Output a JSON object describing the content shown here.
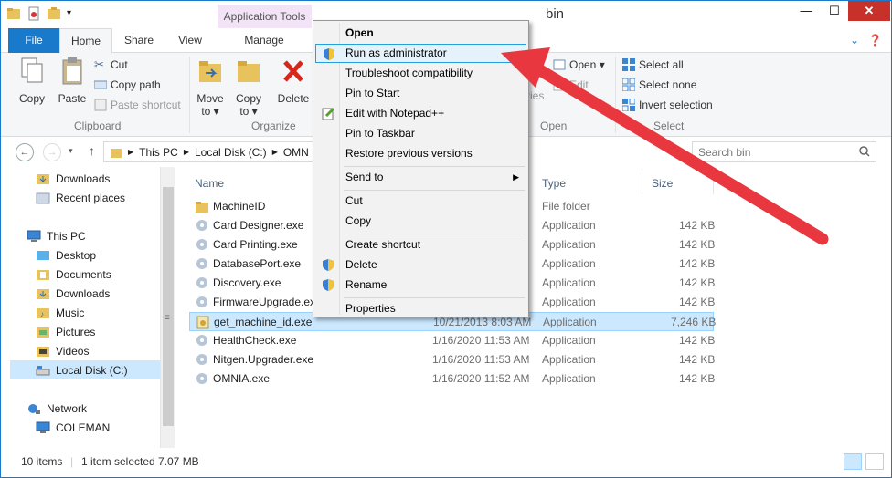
{
  "window": {
    "title": "bin",
    "context_tab": "Application Tools",
    "controls": {
      "minimize": "—",
      "maximize": "☐",
      "close": "✕"
    }
  },
  "ribbon_tabs": [
    "File",
    "Home",
    "Share",
    "View",
    "Manage"
  ],
  "ribbon": {
    "clipboard": {
      "label": "Clipboard",
      "copy": "Copy",
      "paste": "Paste",
      "cut": "Cut",
      "copy_path": "Copy path",
      "paste_shortcut": "Paste shortcut"
    },
    "organize": {
      "label": "Organize",
      "move_to": "Move",
      "move_to2": "to ▾",
      "copy_to": "Copy",
      "copy_to2": "to ▾",
      "delete": "Delete"
    },
    "open": {
      "label": "Open",
      "properties_partial": "rties",
      "open": "Open ▾",
      "edit": "Edit"
    },
    "select": {
      "label": "Select",
      "select_all": "Select all",
      "select_none": "Select none",
      "invert": "Invert selection"
    }
  },
  "address": {
    "crumbs": [
      "This PC",
      "Local Disk (C:)",
      "OMN"
    ],
    "search_placeholder": "Search bin"
  },
  "nav": {
    "downloads_top": "Downloads",
    "recent": "Recent places",
    "this_pc": "This PC",
    "desktop": "Desktop",
    "documents": "Documents",
    "downloads": "Downloads",
    "music": "Music",
    "pictures": "Pictures",
    "videos": "Videos",
    "local_disk": "Local Disk (C:)",
    "network": "Network",
    "coleman": "COLEMAN"
  },
  "columns": {
    "name": "Name",
    "type": "Type",
    "size": "Size"
  },
  "files": [
    {
      "name": "MachineID",
      "date": "",
      "type": "File folder",
      "size": ""
    },
    {
      "name": "Card Designer.exe",
      "date": "",
      "type": "Application",
      "size": "142 KB"
    },
    {
      "name": "Card Printing.exe",
      "date": "",
      "type": "Application",
      "size": "142 KB"
    },
    {
      "name": "DatabasePort.exe",
      "date": "",
      "type": "Application",
      "size": "142 KB"
    },
    {
      "name": "Discovery.exe",
      "date": "",
      "type": "Application",
      "size": "142 KB"
    },
    {
      "name": "FirmwareUpgrade.exe",
      "date": "",
      "type": "Application",
      "size": "142 KB"
    },
    {
      "name": "get_machine_id.exe",
      "date": "10/21/2013 8:03 AM",
      "type": "Application",
      "size": "7,246 KB"
    },
    {
      "name": "HealthCheck.exe",
      "date": "1/16/2020 11:53 AM",
      "type": "Application",
      "size": "142 KB"
    },
    {
      "name": "Nitgen.Upgrader.exe",
      "date": "1/16/2020 11:53 AM",
      "type": "Application",
      "size": "142 KB"
    },
    {
      "name": "OMNIA.exe",
      "date": "1/16/2020 11:52 AM",
      "type": "Application",
      "size": "142 KB"
    }
  ],
  "status": {
    "items": "10 items",
    "selected": "1 item selected",
    "size": "7.07 MB"
  },
  "context_menu": {
    "open": "Open",
    "run_admin": "Run as administrator",
    "troubleshoot": "Troubleshoot compatibility",
    "pin_start": "Pin to Start",
    "edit_npp": "Edit with Notepad++",
    "pin_taskbar": "Pin to Taskbar",
    "restore": "Restore previous versions",
    "send_to": "Send to",
    "cut": "Cut",
    "copy": "Copy",
    "create_shortcut": "Create shortcut",
    "delete": "Delete",
    "rename": "Rename",
    "properties": "Properties"
  },
  "colors": {
    "accent": "#1979ca",
    "annotation_arrow": "#e8373e",
    "selection": "#cce8ff"
  }
}
